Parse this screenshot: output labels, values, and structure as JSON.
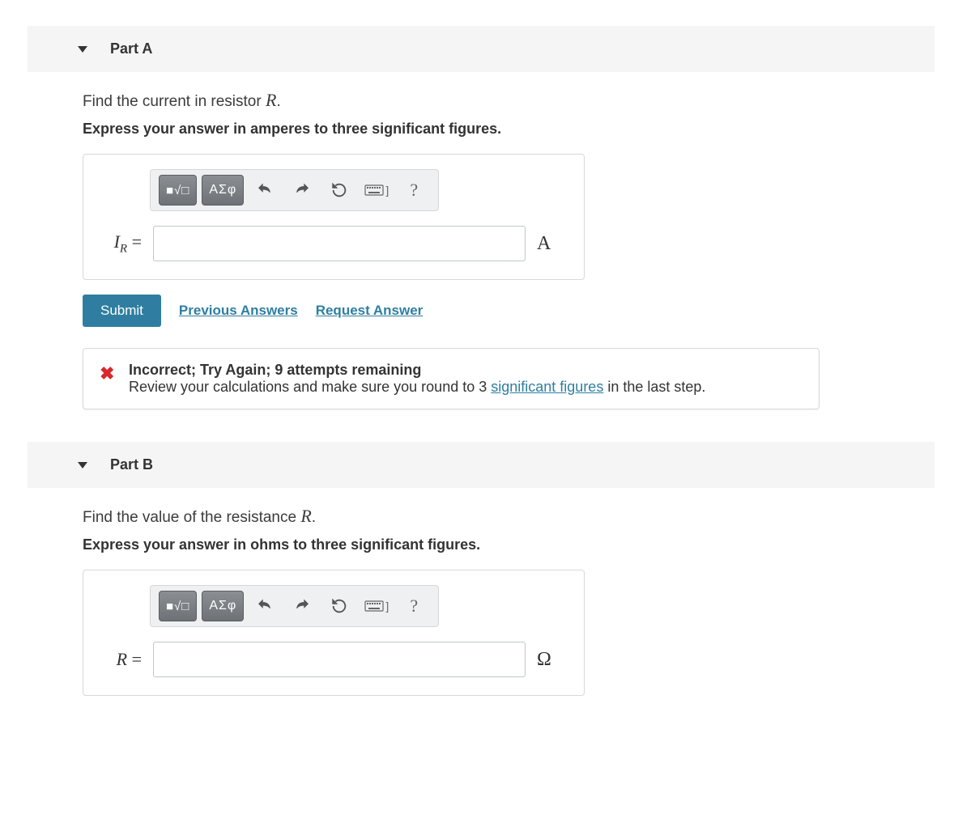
{
  "partA": {
    "title": "Part A",
    "prompt_pre": "Find the current in resistor ",
    "prompt_var": "R",
    "prompt_post": ".",
    "instruction": "Express your answer in amperes to three significant figures.",
    "toolbar": {
      "math_label": "■√□",
      "greek_label": "ΑΣφ"
    },
    "lhs_var": "I",
    "lhs_sub": "R",
    "equals": " =",
    "unit": "A",
    "submit": "Submit",
    "prev_answers": "Previous Answers",
    "request_answer": "Request Answer",
    "feedback": {
      "title": "Incorrect; Try Again; 9 attempts remaining",
      "body_pre": "Review your calculations and make sure you round to 3 ",
      "body_link": "significant figures",
      "body_post": " in the last step."
    }
  },
  "partB": {
    "title": "Part B",
    "prompt_pre": "Find the value of the resistance ",
    "prompt_var": "R",
    "prompt_post": ".",
    "instruction": "Express your answer in ohms to three significant figures.",
    "toolbar": {
      "math_label": "■√□",
      "greek_label": "ΑΣφ"
    },
    "lhs_var": "R",
    "equals": " =",
    "unit": "Ω"
  }
}
